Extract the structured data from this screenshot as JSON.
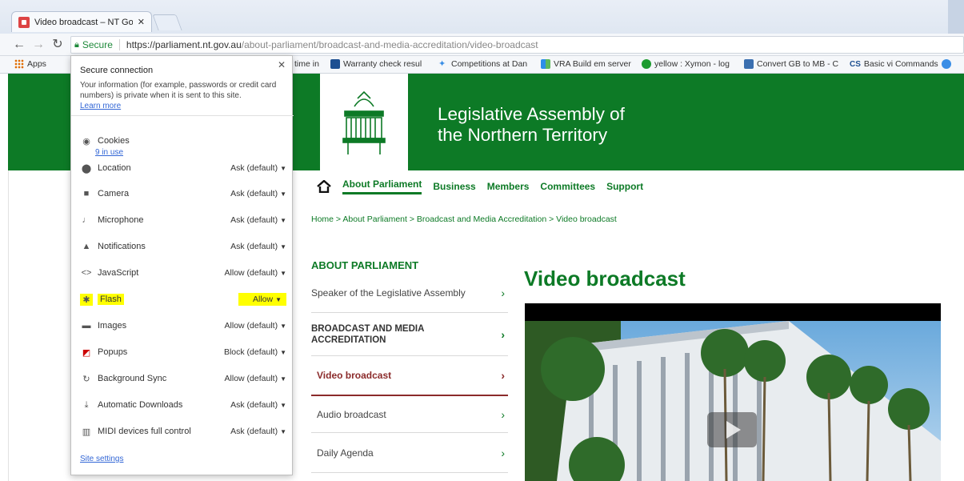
{
  "browser": {
    "tab_title": "Video broadcast – NT Go",
    "secure_label": "Secure",
    "url_host": "https://parliament.nt.gov.au",
    "url_path": "/about-parliament/broadcast-and-media-accreditation/video-broadcast"
  },
  "bookmarks": {
    "apps": "Apps",
    "items": [
      {
        "label": "time in"
      },
      {
        "label": "Warranty check resul"
      },
      {
        "label": "Competitions at Dan"
      },
      {
        "label": "VRA Build em server"
      },
      {
        "label": "yellow : Xymon - log"
      },
      {
        "label": "Convert GB to MB - C"
      },
      {
        "label": "Basic vi Commands"
      }
    ]
  },
  "popup": {
    "title": "Secure connection",
    "description": "Your information (for example, passwords or credit card numbers) is private when it is sent to this site.",
    "learn_more": "Learn more",
    "cookies_label": "Cookies",
    "cookies_sub": "9 in use",
    "permissions": [
      {
        "label": "Location",
        "value": "Ask (default)",
        "icon": "location-pin-icon"
      },
      {
        "label": "Camera",
        "value": "Ask (default)",
        "icon": "camera-icon"
      },
      {
        "label": "Microphone",
        "value": "Ask (default)",
        "icon": "microphone-icon"
      },
      {
        "label": "Notifications",
        "value": "Ask (default)",
        "icon": "bell-icon"
      },
      {
        "label": "JavaScript",
        "value": "Allow (default)",
        "icon": "code-icon"
      },
      {
        "label": "Flash",
        "value": "Allow",
        "icon": "puzzle-icon",
        "highlight": "#ffff00"
      },
      {
        "label": "Images",
        "value": "Allow (default)",
        "icon": "image-icon"
      },
      {
        "label": "Popups",
        "value": "Block (default)",
        "icon": "popup-icon"
      },
      {
        "label": "Background Sync",
        "value": "Allow (default)",
        "icon": "sync-icon"
      },
      {
        "label": "Automatic Downloads",
        "value": "Ask (default)",
        "icon": "download-icon"
      },
      {
        "label": "MIDI devices full control",
        "value": "Ask (default)",
        "icon": "midi-icon"
      }
    ],
    "site_settings": "Site settings"
  },
  "site": {
    "title_line1": "Legislative Assembly of",
    "title_line2": "the Northern Territory",
    "brand_color": "#0d7a26",
    "nav": [
      "About Parliament",
      "Business",
      "Members",
      "Committees",
      "Support"
    ],
    "breadcrumb": "Home > About Parliament > Broadcast and Media Accreditation > Video broadcast",
    "side_title": "ABOUT PARLIAMENT",
    "side_items": [
      {
        "label": "Speaker of the Legislative Assembly"
      },
      {
        "label": "BROADCAST AND MEDIA ACCREDITATION"
      },
      {
        "label": "Video broadcast"
      },
      {
        "label": "Audio broadcast"
      },
      {
        "label": "Daily Agenda"
      }
    ],
    "heading": "Video broadcast"
  }
}
